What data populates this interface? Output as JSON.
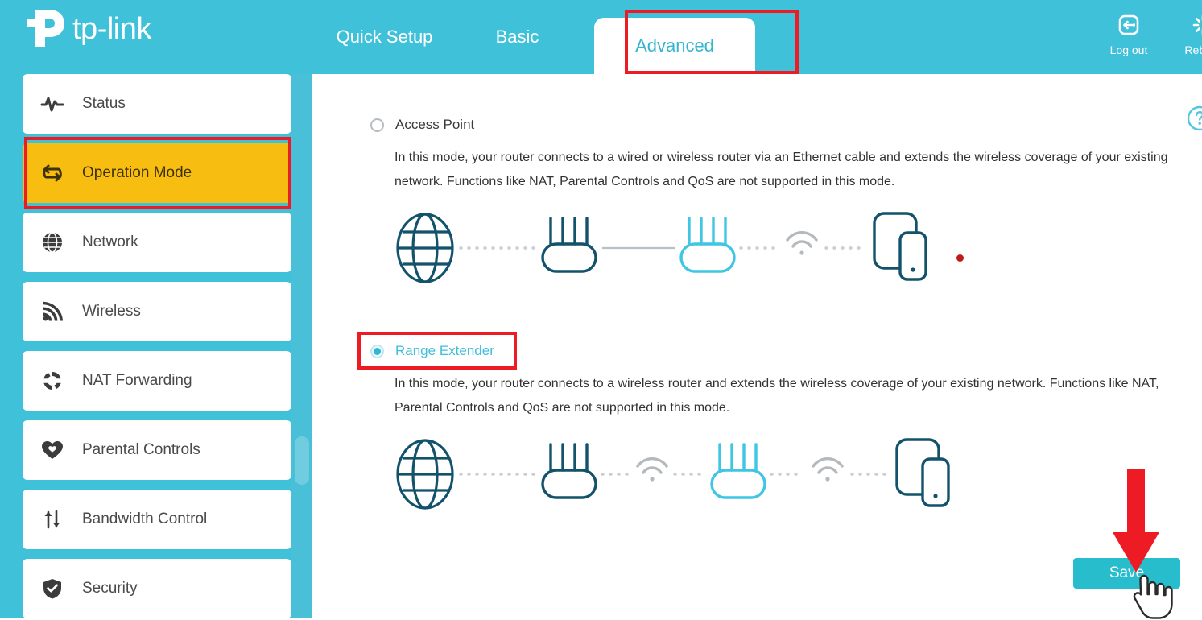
{
  "brand": {
    "name": "tp-link",
    "logo_icon": "tp-link-logo"
  },
  "header": {
    "background_color": "#3FC1DA",
    "tabs": [
      {
        "label": "Quick Setup",
        "active": false
      },
      {
        "label": "Basic",
        "active": false
      },
      {
        "label": "Advanced",
        "active": true
      }
    ],
    "actions": [
      {
        "label": "Log out",
        "icon": "logout-icon"
      },
      {
        "label": "Reboot",
        "icon": "reboot-icon"
      }
    ]
  },
  "sidebar": {
    "items": [
      {
        "label": "Status",
        "icon": "activity-pulse-icon",
        "active": false
      },
      {
        "label": "Operation Mode",
        "icon": "swap-arrows-icon",
        "active": true
      },
      {
        "label": "Network",
        "icon": "globe-icon",
        "active": false
      },
      {
        "label": "Wireless",
        "icon": "wifi-signal-icon",
        "active": false
      },
      {
        "label": "NAT Forwarding",
        "icon": "circular-arrows-icon",
        "active": false
      },
      {
        "label": "Parental Controls",
        "icon": "heart-icon",
        "active": false
      },
      {
        "label": "Bandwidth Control",
        "icon": "up-down-arrows-icon",
        "active": false
      },
      {
        "label": "Security",
        "icon": "shield-check-icon",
        "active": false
      }
    ],
    "active_highlight_color": "#F7BE11"
  },
  "main": {
    "modes": [
      {
        "name": "Access Point",
        "selected": false,
        "description": "In this mode, your router connects to a wired or wireless router via an Ethernet cable and extends the wireless coverage of your existing network. Functions like NAT, Parental Controls and QoS are not supported in this mode.",
        "topology": [
          "globe-icon",
          "router-dark-icon",
          "ethernet-line",
          "router-cyan-icon",
          "wifi-icon",
          "devices-icon"
        ]
      },
      {
        "name": "Range Extender",
        "selected": true,
        "description": "In this mode, your router connects to a wireless router and extends the wireless coverage of your existing network. Functions like NAT, Parental Controls and QoS are not supported in this mode.",
        "topology": [
          "globe-icon",
          "router-dark-icon",
          "wifi-icon",
          "router-cyan-icon",
          "wifi-icon",
          "devices-icon"
        ]
      }
    ],
    "save_label": "Save",
    "save_color": "#27BDCC",
    "help_icon": "help-circle-icon"
  },
  "annotations": {
    "highlight_color": "#ED1C24",
    "boxes": [
      "advanced-tab",
      "operation-mode-sidebar-item",
      "range-extender-radio"
    ],
    "arrow": "red-down-arrow-to-save",
    "cursor": "hand-pointer"
  }
}
